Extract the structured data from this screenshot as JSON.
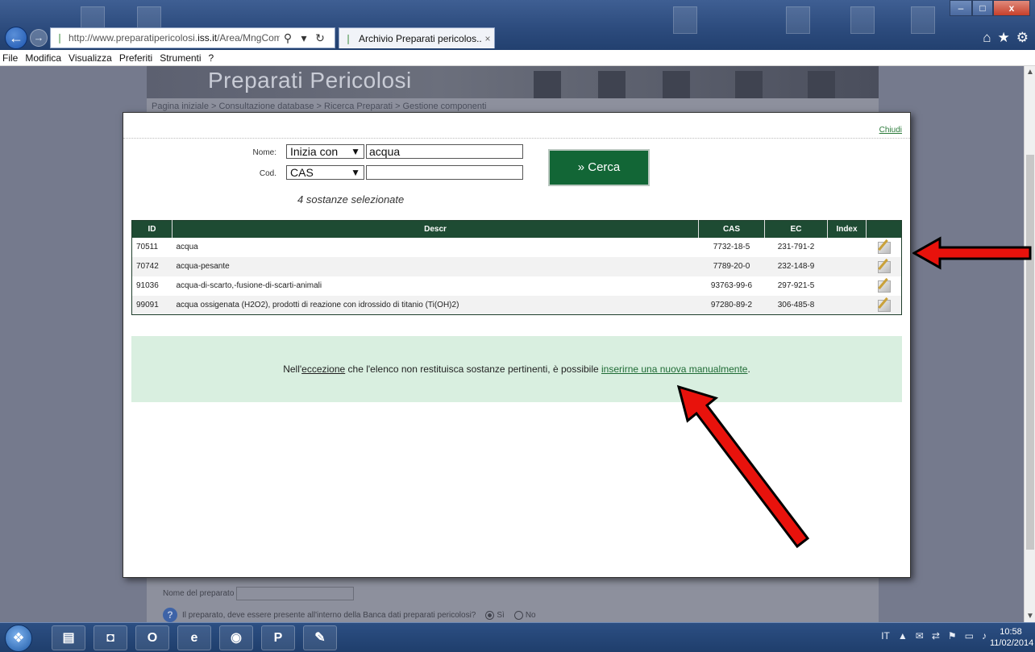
{
  "browser": {
    "url_prefix": "http://www.preparatipericolosi.",
    "url_domain": "iss.it",
    "url_suffix": "/Area/MngCom",
    "tab_title": "Archivio Preparati pericolos...",
    "tab_close": "×",
    "search_glyph": "⚲",
    "refresh_glyph": "↻",
    "back_glyph": "←",
    "forward_glyph": "→"
  },
  "menu": [
    "File",
    "Modifica",
    "Visualizza",
    "Preferiti",
    "Strumenti",
    "?"
  ],
  "site": {
    "title": "Preparati Pericolosi",
    "breadcrumb": "Pagina iniziale  >  Consultazione database  >  Ricerca Preparati  >  Gestione componenti",
    "behind_name_label": "Nome del preparato",
    "behind_question": "Il preparato, deve essere presente all'interno della Banca dati preparati pericolosi?",
    "behind_yes": "Sì",
    "behind_no": "No"
  },
  "modal": {
    "close_label": "Chiudi",
    "search": {
      "name_label": "Nome:",
      "name_mode": "Inizia con",
      "name_value": "acqua",
      "code_label": "Cod.",
      "code_type": "CAS",
      "code_value": "",
      "search_button": "» Cerca",
      "result_count": "4 sostanze selezionate"
    },
    "table": {
      "headers": [
        "ID",
        "Descr",
        "CAS",
        "EC",
        "Index",
        ""
      ],
      "rows": [
        {
          "id": "70511",
          "descr": "acqua",
          "cas": "7732-18-5",
          "ec": "231-791-2",
          "index": ""
        },
        {
          "id": "70742",
          "descr": "acqua-pesante",
          "cas": "7789-20-0",
          "ec": "232-148-9",
          "index": ""
        },
        {
          "id": "91036",
          "descr": "acqua-di-scarto,-fusione-di-scarti-animali",
          "cas": "93763-99-6",
          "ec": "297-921-5",
          "index": ""
        },
        {
          "id": "99091",
          "descr": "acqua ossigenata (H2O2), prodotti di reazione con idrossido di titanio (Ti(OH)2)",
          "cas": "97280-89-2",
          "ec": "306-485-8",
          "index": ""
        }
      ]
    },
    "notice": {
      "pre": "Nell'",
      "emph": "eccezione",
      "mid": " che l'elenco non restituisca sostanze pertinenti, è possibile ",
      "link": "inserirne una nuova manualmente",
      "post": "."
    }
  },
  "taskbar": {
    "time": "10:58",
    "date": "11/02/2014",
    "lang": "IT"
  },
  "colors": {
    "header_green": "#1e4b33",
    "button_green": "#126636",
    "notice_bg": "#d9efe0",
    "arrow_red": "#e8120c"
  }
}
